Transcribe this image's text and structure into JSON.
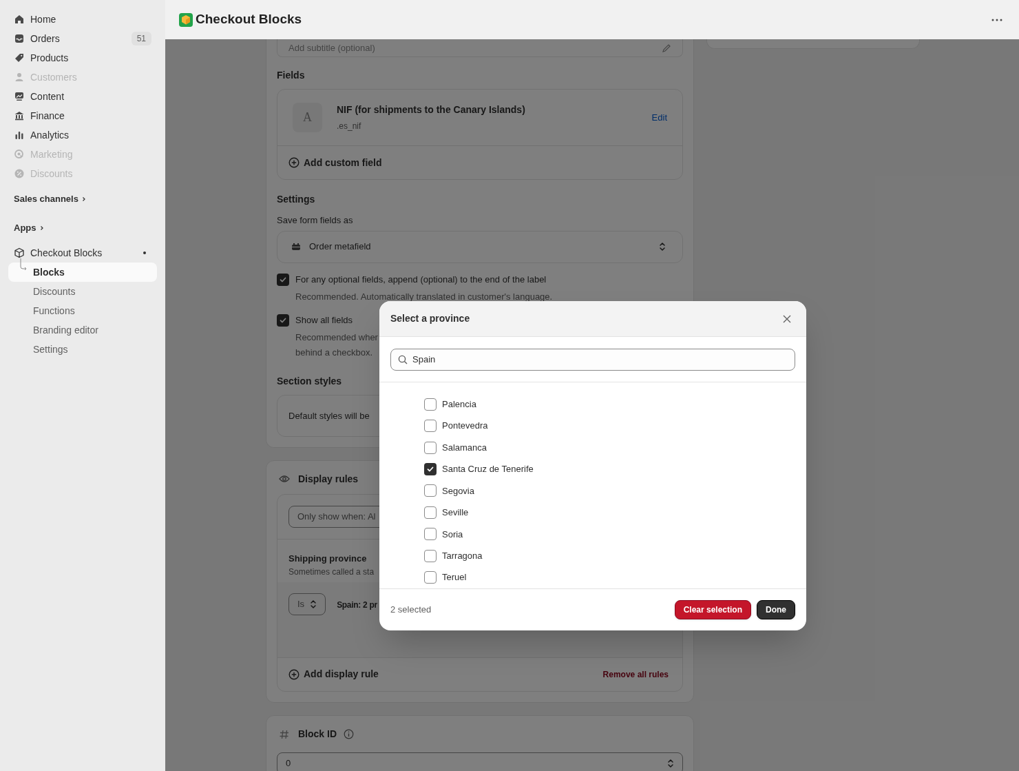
{
  "sidebar": {
    "nav": [
      {
        "label": "Home",
        "disabled": false
      },
      {
        "label": "Orders",
        "badge": "51",
        "disabled": false
      },
      {
        "label": "Products",
        "disabled": false
      },
      {
        "label": "Customers",
        "disabled": true
      },
      {
        "label": "Content",
        "disabled": false
      },
      {
        "label": "Finance",
        "disabled": false
      },
      {
        "label": "Analytics",
        "disabled": false
      },
      {
        "label": "Marketing",
        "disabled": true
      },
      {
        "label": "Discounts",
        "disabled": true
      }
    ],
    "sections": [
      "Sales channels",
      "Apps"
    ],
    "app": {
      "name": "Checkout Blocks",
      "items": [
        {
          "label": "Blocks",
          "selected": true
        },
        {
          "label": "Discounts",
          "selected": false
        },
        {
          "label": "Functions",
          "selected": false
        },
        {
          "label": "Branding editor",
          "selected": false
        },
        {
          "label": "Settings",
          "selected": false
        }
      ]
    }
  },
  "header": {
    "title": "Checkout Blocks"
  },
  "block": {
    "subtitle_placeholder": "Add subtitle (optional)",
    "fields_heading": "Fields",
    "field": {
      "avatar": "A",
      "name": "NIF (for shipments to the Canary Islands)",
      "key": ".es_nif",
      "action": "Edit"
    },
    "add_field": "Add custom field",
    "settings_heading": "Settings",
    "save_label": "Save form fields as",
    "save_value": "Order metafield",
    "options": [
      {
        "label": "For any optional fields, append (optional) to the end of the label",
        "help": [
          "Recommended. Automatically translated in customer's language."
        ],
        "checked": true
      },
      {
        "label": "Show all fields",
        "help": [
          "Recommended wher",
          "behind a checkbox."
        ],
        "checked": true
      }
    ],
    "styles_heading": "Section styles",
    "styles_text": "Default styles will be"
  },
  "display_rules": {
    "title": "Display rules",
    "condition": "Only show when: Al",
    "rule_title": "Shipping province",
    "rule_help": "Sometimes called a sta",
    "operator": "Is",
    "value": "Spain: 2 pr",
    "add": "Add display rule",
    "remove": "Remove all rules"
  },
  "block_id": {
    "title": "Block ID",
    "value": "0"
  },
  "modal": {
    "title": "Select a province",
    "search": "Spain",
    "provinces": [
      {
        "label": "Palencia",
        "checked": false
      },
      {
        "label": "Pontevedra",
        "checked": false
      },
      {
        "label": "Salamanca",
        "checked": false
      },
      {
        "label": "Santa Cruz de Tenerife",
        "checked": true
      },
      {
        "label": "Segovia",
        "checked": false
      },
      {
        "label": "Seville",
        "checked": false
      },
      {
        "label": "Soria",
        "checked": false
      },
      {
        "label": "Tarragona",
        "checked": false
      },
      {
        "label": "Teruel",
        "checked": false
      }
    ],
    "count": "2 selected",
    "clear": "Clear selection",
    "done": "Done"
  }
}
